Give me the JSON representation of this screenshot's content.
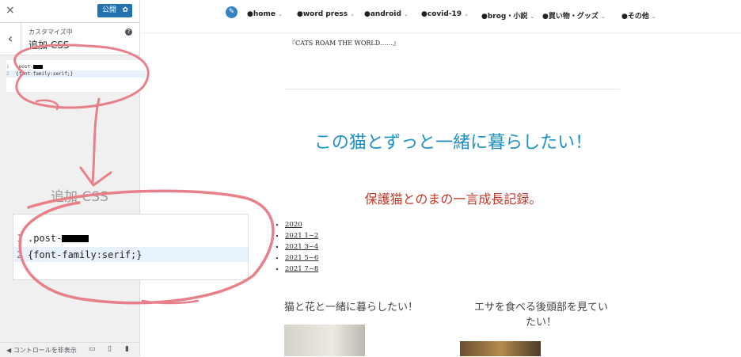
{
  "customizer": {
    "close_icon": "×",
    "publish_label": "公開",
    "back_icon": "‹",
    "section_label": "カスタマイズ中",
    "section_title": "追加 CSS",
    "help_icon": "?",
    "hide_controls_label": "コントロールを非表示"
  },
  "css_editor": {
    "line_numbers": [
      "1",
      "2"
    ],
    "line1": ".post-",
    "line2": "{font-family:serif;}"
  },
  "zoom": {
    "title": "追加 CSS"
  },
  "site": {
    "nav_items": [
      {
        "label": "●home"
      },
      {
        "label": "●word press"
      },
      {
        "label": "●android"
      },
      {
        "label": "●covid-19"
      },
      {
        "label": "●brog・小説"
      },
      {
        "label": "●買い物・グッズ"
      },
      {
        "label": "●その他"
      }
    ],
    "intro": "『CATS ROAM THE WORLD……』",
    "title": "この猫とずっと一緒に暮らしたい！",
    "subtitle": "保護猫とのまの一言成長記録。",
    "archive": [
      "2020",
      "2021 1~2",
      "2021 3~4",
      "2021 5~6",
      "2021 7~8"
    ],
    "posts": [
      {
        "title": "猫と花と一緒に暮らしたい！"
      },
      {
        "title_line1": "エサを食べる後頭部を見てい",
        "title_line2": "たい！"
      }
    ]
  },
  "colors": {
    "publish": "#2271b1",
    "site_title": "#1e90c8",
    "site_subtitle": "#c0392b",
    "annotation": "#e8808a"
  }
}
